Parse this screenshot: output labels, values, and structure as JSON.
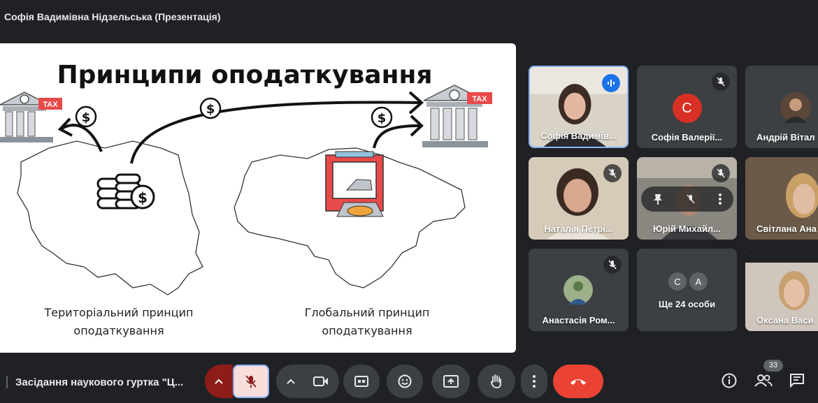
{
  "window": {
    "title": "Софія Вадимівна Нідзельська (Презентація)"
  },
  "slide": {
    "title": "Принципи оподаткування",
    "tax_label": "TAX",
    "dollar_symbol": "$",
    "left_caption_line1": "Територіальний принцип",
    "left_caption_line2": "оподаткування",
    "right_caption_line1": "Глобальний принцип",
    "right_caption_line2": "оподаткування"
  },
  "participants": [
    {
      "name": "Софія Вадимів...",
      "state": "speaking"
    },
    {
      "name": "Софія Валерії...",
      "initial": "C",
      "avatar_color": "#d93025",
      "state": "muted"
    },
    {
      "name": "Андрій Вітал",
      "state": "normal"
    },
    {
      "name": "Наталія Петрі...",
      "state": "muted"
    },
    {
      "name": "Юрій Михайл...",
      "state": "muted"
    },
    {
      "name": "Світлана Ана",
      "state": "normal"
    },
    {
      "name": "Анастасія Ром...",
      "state": "muted"
    },
    {
      "name": "Ще 24 особи",
      "initials": [
        "C",
        "A"
      ],
      "avatar_colors": [
        "#5f6368",
        "#5f6368"
      ]
    },
    {
      "name": "Оксана Васи",
      "state": "normal"
    }
  ],
  "toolbar": {
    "meeting_name": "Засідання наукового гуртка \"Ц...",
    "participant_count": "33",
    "accent_end_call": "#ea4335",
    "accent_mic_off": "#f9dedc"
  }
}
